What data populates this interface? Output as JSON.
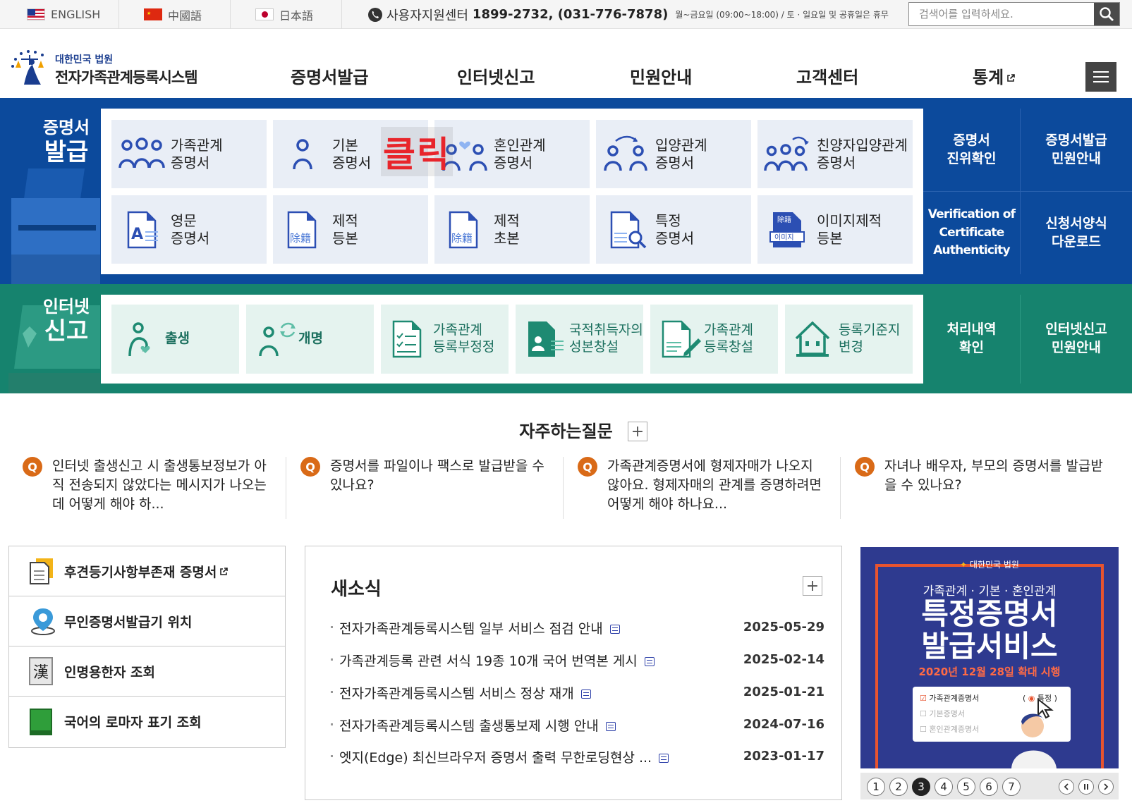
{
  "topbar": {
    "lang_en": "ENGLISH",
    "lang_zh": "中國語",
    "lang_ja": "日本語",
    "support_label": "사용자지원센터",
    "support_phone": "1899-2732, (031-776-7878)",
    "support_hours": "월~금요일 (09:00~18:00) / 토 · 일요일 및 공휴일은 휴무",
    "search_placeholder": "검색어를 입력하세요."
  },
  "header": {
    "logo_line1": "대한민국 법원",
    "logo_line2": "전자가족관계등록시스템",
    "nav": [
      "증명서발급",
      "인터넷신고",
      "민원안내",
      "고객센터",
      "통계"
    ]
  },
  "cert": {
    "title_line1": "증명서",
    "title_line2": "발급",
    "tiles": [
      [
        "가족관계",
        "증명서"
      ],
      [
        "기본",
        "증명서"
      ],
      [
        "혼인관계",
        "증명서"
      ],
      [
        "입양관계",
        "증명서"
      ],
      [
        "친양자입양관계",
        "증명서"
      ],
      [
        "영문",
        "증명서"
      ],
      [
        "제적",
        "등본"
      ],
      [
        "제적",
        "초본"
      ],
      [
        "특정",
        "증명서"
      ],
      [
        "이미지제적",
        "등본"
      ]
    ],
    "side": [
      [
        "증명서",
        "진위확인"
      ],
      [
        "증명서발급",
        "민원안내"
      ],
      [
        "Verification of",
        "Certificate",
        "Authenticity"
      ],
      [
        "신청서양식",
        "다운로드"
      ]
    ],
    "icon_text_jejeok": "除籍",
    "icon_text_image": "이미지",
    "icon_text_image_top": "除籍"
  },
  "report": {
    "title_line1": "인터넷",
    "title_line2": "신고",
    "tiles": [
      [
        "출생"
      ],
      [
        "개명"
      ],
      [
        "가족관계",
        "등록부정정"
      ],
      [
        "국적취득자의",
        "성본창설"
      ],
      [
        "가족관계",
        "등록창설"
      ],
      [
        "등록기준지",
        "변경"
      ]
    ],
    "side": [
      [
        "처리내역",
        "확인"
      ],
      [
        "인터넷신고",
        "민원안내"
      ]
    ]
  },
  "click_overlay": "클릭",
  "faq": {
    "title": "자주하는질문",
    "plus": "+",
    "q_badge": "Q",
    "items": [
      "인터넷 출생신고 시 출생통보정보가 아직 전송되지 않았다는 메시지가 나오는데 어떻게 해야 하...",
      "증명서를 파일이나 팩스로 발급받을 수 있나요?",
      "가족관계증명서에 형제자매가 나오지 않아요. 형제자매의 관계를 증명하려면 어떻게 해야 하나요...",
      "자녀나 배우자, 부모의 증명서를 발급받을 수 있나요?"
    ]
  },
  "quicklinks": [
    "후견등기사항부존재 증명서",
    "무인증명서발급기 위치",
    "인명용한자 조회",
    "국어의 로마자 표기 조회"
  ],
  "quicklink_hanja": "漢",
  "news": {
    "title": "새소식",
    "plus": "+",
    "items": [
      {
        "title": "전자가족관계등록시스템 일부 서비스 점검 안내",
        "date": "2025-05-29"
      },
      {
        "title": "가족관계등록 관련 서식 19종 10개 국어 번역본 게시",
        "date": "2025-02-14"
      },
      {
        "title": "전자가족관계등록시스템 서비스 정상 재개",
        "date": "2025-01-21"
      },
      {
        "title": "전자가족관계등록시스템 출생통보제 시행 안내",
        "date": "2024-07-16"
      },
      {
        "title": "엣지(Edge) 최신브라우저 증명서 출력 무한로딩현상 ...",
        "date": "2023-01-17"
      }
    ]
  },
  "banner": {
    "org": "대한민국 법원",
    "subtitle": "가족관계 · 기본 · 혼인관계",
    "title1": "특정증명서",
    "title2": "발급서비스",
    "date": "2020년 12월 28일 확대 시행",
    "opts": [
      "가족관계증명서",
      "기본증명서",
      "혼인관계증명서"
    ],
    "opt_tag": "특정",
    "pages": [
      "1",
      "2",
      "3",
      "4",
      "5",
      "6",
      "7"
    ],
    "current_page": "3"
  }
}
